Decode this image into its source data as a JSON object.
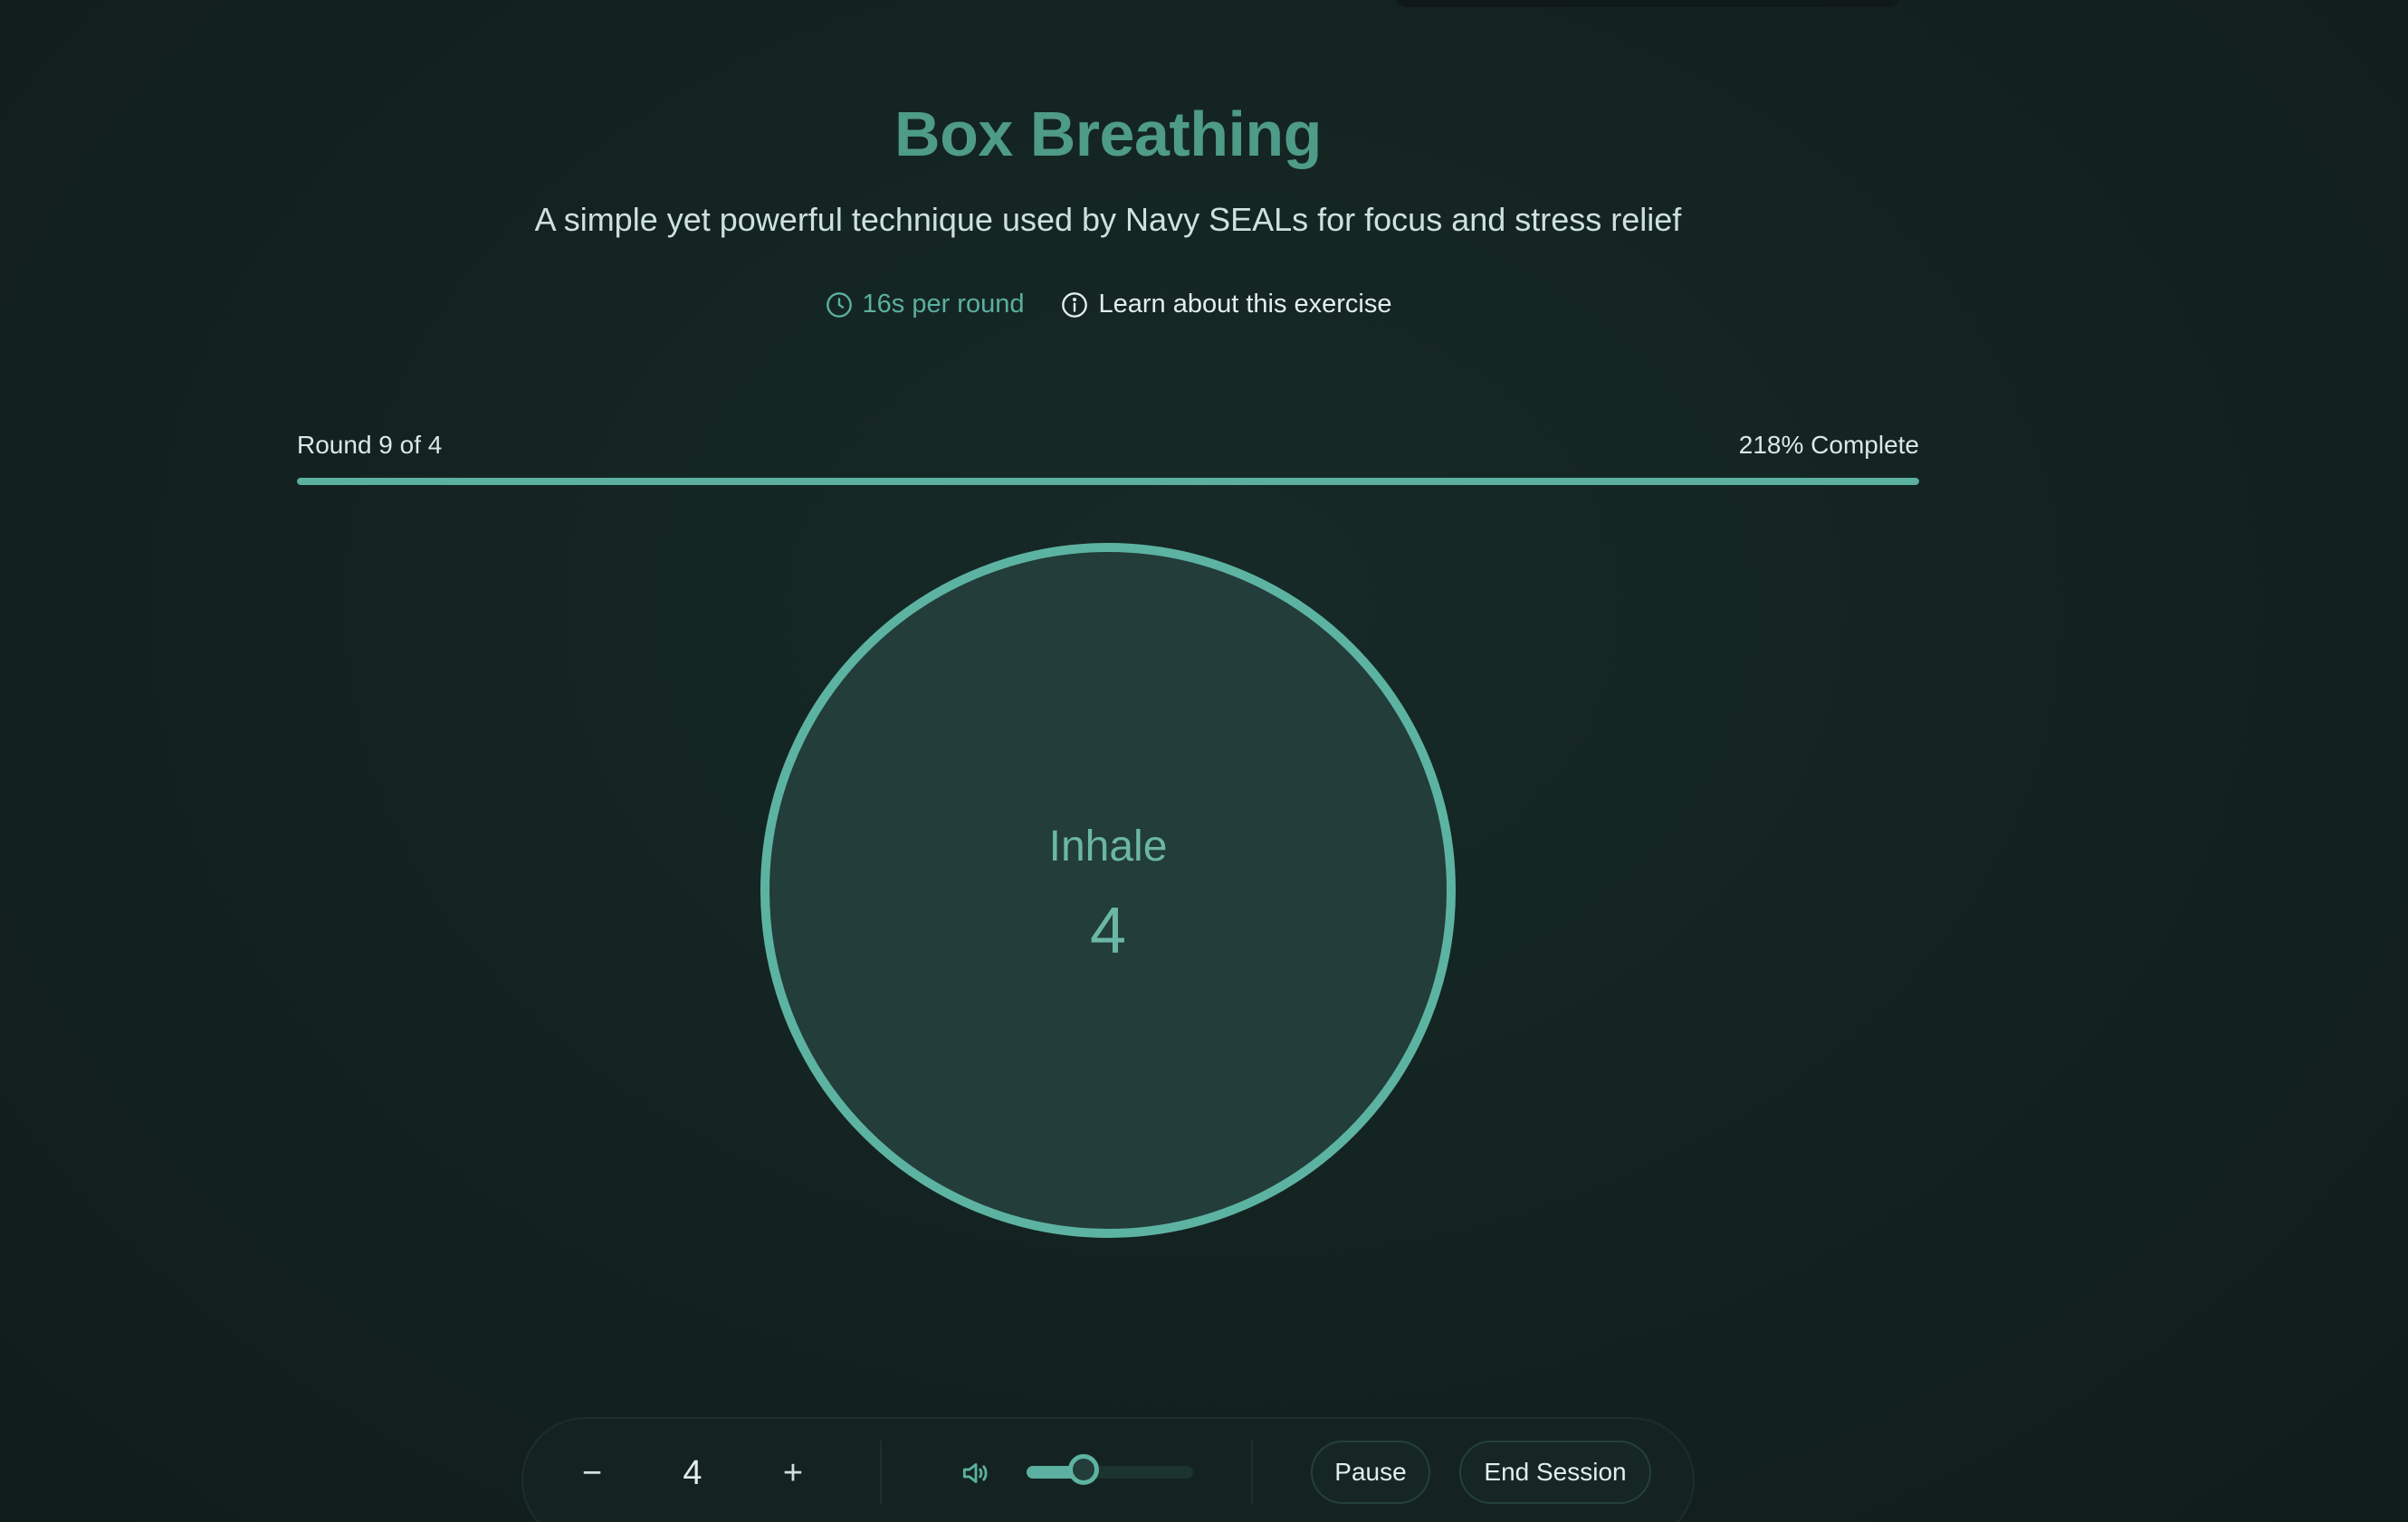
{
  "header": {
    "title": "Box Breathing",
    "subtitle": "A simple yet powerful technique used by Navy SEALs for focus and stress relief"
  },
  "meta": {
    "duration": "16s per round",
    "duration_icon": "clock-icon",
    "learn_label": "Learn about this exercise",
    "learn_icon": "info-icon"
  },
  "progress": {
    "round_label": "Round 9 of 4",
    "percent_label": "218% Complete",
    "fill_fraction": 1.0
  },
  "breath": {
    "phase": "Inhale",
    "count": "4"
  },
  "controls": {
    "decrement_label": "−",
    "count_value": "4",
    "increment_label": "+",
    "volume_icon": "volume-icon",
    "volume_level": 0.34,
    "pause_label": "Pause",
    "end_label": "End Session"
  },
  "colors": {
    "accent": "#5bb0a0",
    "title": "#4e9b88",
    "background": "#132120"
  }
}
